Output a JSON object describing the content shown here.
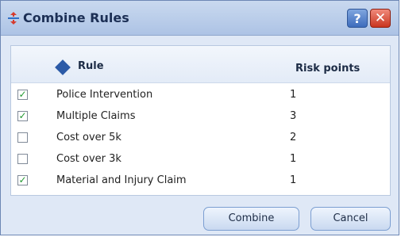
{
  "dialog": {
    "title": "Combine Rules",
    "help_label": "?",
    "close_label": "✕"
  },
  "table": {
    "headers": {
      "rule": "Rule",
      "risk_points": "Risk points"
    },
    "rows": [
      {
        "checked": true,
        "rule": "Police Intervention",
        "points": "1"
      },
      {
        "checked": true,
        "rule": "Multiple Claims",
        "points": "3"
      },
      {
        "checked": false,
        "rule": "Cost over 5k",
        "points": "2"
      },
      {
        "checked": false,
        "rule": "Cost over 3k",
        "points": "1"
      },
      {
        "checked": true,
        "rule": "Material and Injury Claim",
        "points": "1"
      }
    ]
  },
  "buttons": {
    "combine": "Combine",
    "cancel": "Cancel"
  },
  "colors": {
    "accent": "#2b5aa7",
    "check": "#229931",
    "close": "#c9351f"
  },
  "icons": {
    "title": "combine-rules-icon",
    "header": "rule-diamond-icon",
    "check": "checkmark-icon"
  }
}
